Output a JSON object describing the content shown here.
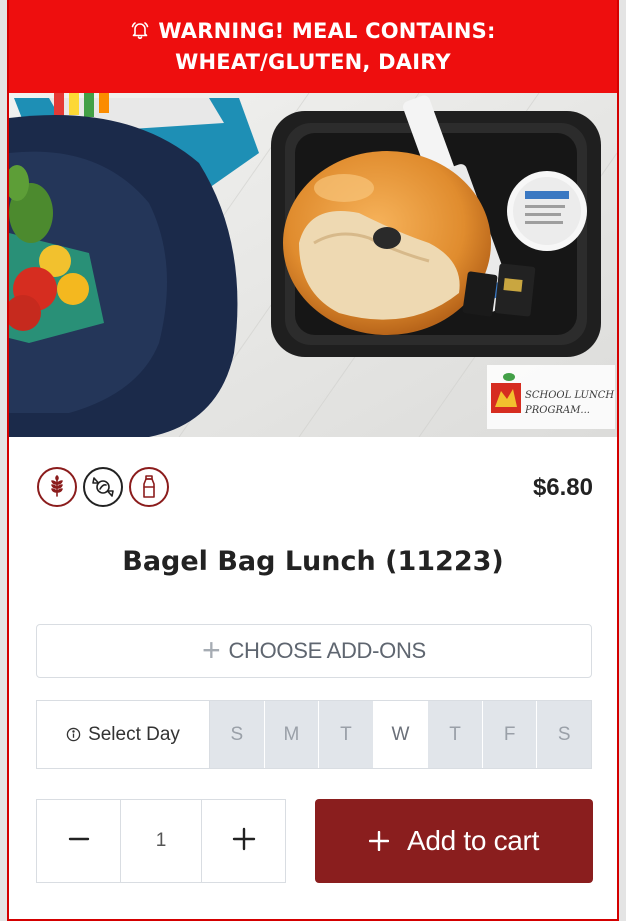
{
  "warning": {
    "line1": "WARNING! MEAL CONTAINS:",
    "line2": "WHEAT/GLUTEN, DAIRY",
    "icon": "bell-icon"
  },
  "hero": {
    "image": "bagel-lunch-photo",
    "logo_text_line1": "SCHOOL LUNCH",
    "logo_text_line2": "PROGRAM..."
  },
  "diet_icons": [
    {
      "name": "wheat-icon"
    },
    {
      "name": "candy-icon"
    },
    {
      "name": "milk-bottle-icon"
    }
  ],
  "price": "$6.80",
  "title": "Bagel Bag Lunch (11223)",
  "addons": {
    "label": "CHOOSE ADD-ONS",
    "icon": "plus-icon"
  },
  "day_selector": {
    "label": "Select Day",
    "icon": "info-circle-icon",
    "days": [
      "S",
      "M",
      "T",
      "W",
      "T",
      "F",
      "S"
    ],
    "selected_index": 3
  },
  "quantity": {
    "value": "1"
  },
  "add_to_cart": {
    "label": "Add to cart",
    "icon": "plus-icon"
  },
  "colors": {
    "warning_bg": "#ee0e0e",
    "accent_red": "#8a1e1e",
    "border": "#d9dde2",
    "day_bg": "#e1e5ea"
  }
}
